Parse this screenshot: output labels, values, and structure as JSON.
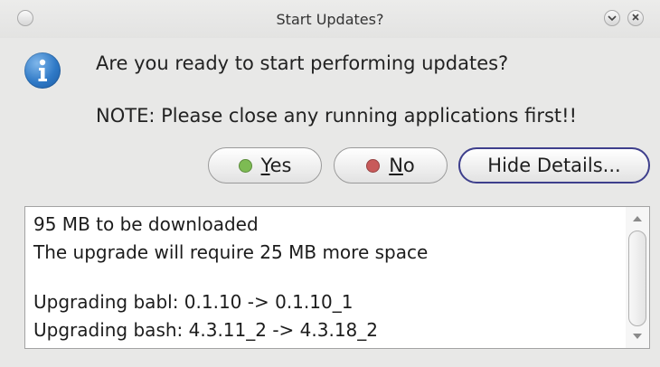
{
  "window": {
    "title": "Start Updates?",
    "menu_glyph": "v",
    "close_glyph": "×"
  },
  "message": {
    "question": "Are you ready to start performing updates?",
    "note": "NOTE: Please close any running applications first!!"
  },
  "buttons": {
    "yes": {
      "accel": "Y",
      "rest": "es",
      "dot_color": "#7dbb53"
    },
    "no": {
      "accel": "N",
      "rest": "o",
      "dot_color": "#c85a5a"
    },
    "details": {
      "label": "Hide Details..."
    }
  },
  "details": {
    "lines": [
      "95 MB to be downloaded",
      "The upgrade will require 25 MB more space",
      "",
      "Upgrading babl: 0.1.10 -> 0.1.10_1",
      "Upgrading bash: 4.3.11_2 -> 4.3.18_2"
    ]
  },
  "colors": {
    "info_icon": "#2f79c6",
    "focus_border": "#3e3f8c"
  },
  "icons": {
    "window_menu": "circle-icon",
    "minimize": "chevron-down-icon",
    "close": "close-icon",
    "info": "info-icon"
  }
}
